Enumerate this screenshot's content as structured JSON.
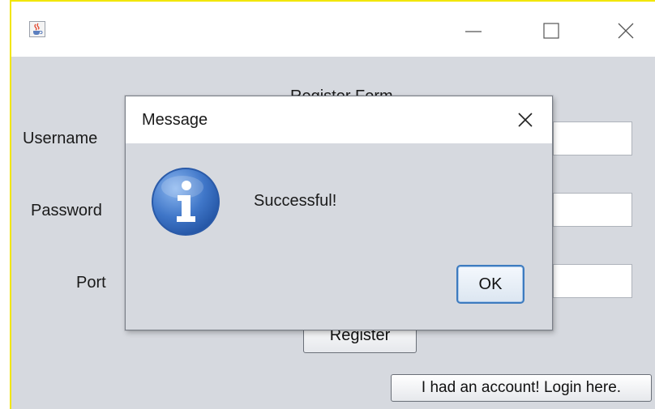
{
  "main_window": {
    "icon": "java-coffee-cup-icon",
    "controls": [
      "minimize-icon",
      "maximize-icon",
      "close-icon"
    ],
    "form_title": "Register Form",
    "labels": {
      "username": "Username",
      "password": "Password",
      "port": "Port"
    },
    "fields": {
      "username_value": "",
      "password_value": "",
      "port_value": ""
    },
    "register_label": "Register",
    "login_link_label": "I had an account! Login here."
  },
  "dialog": {
    "title": "Message",
    "icon": "info-icon",
    "message": "Successful!",
    "ok_label": "OK"
  },
  "colors": {
    "window_bg": "#d6d9df",
    "titlebar_bg": "#ffffff",
    "frame_border": "#f2e600",
    "info_blue": "#2f64b6",
    "ok_border": "#3d7bbf"
  }
}
